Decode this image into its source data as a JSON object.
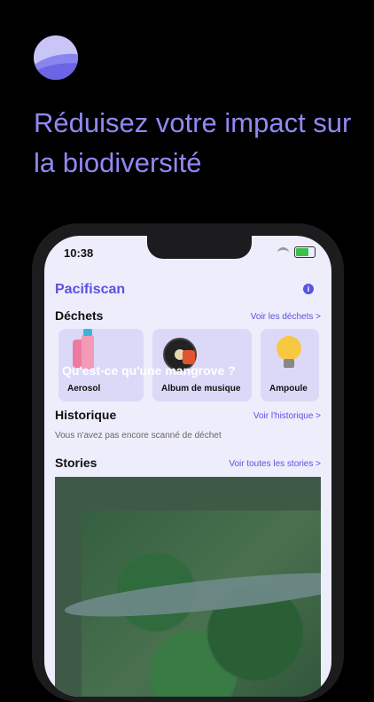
{
  "headline": "Réduisez votre impact sur la biodiversité",
  "phone": {
    "time": "10:38",
    "app_title": "Pacifiscan",
    "info_icon": "i",
    "dechets": {
      "title": "Déchets",
      "link": "Voir les déchets >",
      "items": [
        {
          "label": "Aerosol",
          "icon": "aerosol-icon"
        },
        {
          "label": "Album de musique",
          "icon": "vinyl-record-icon"
        },
        {
          "label": "Ampoule",
          "icon": "light-bulb-icon"
        }
      ]
    },
    "historique": {
      "title": "Historique",
      "link": "Voir l'historique >",
      "empty": "Vous n'avez pas encore scanné de déchet"
    },
    "stories": {
      "title": "Stories",
      "link": "Voir toutes les stories >",
      "caption": "Qu'est-ce qu'une mangrove ?"
    },
    "colors": {
      "accent": "#5a52e0",
      "headline": "#8f8af2",
      "background": "#000000"
    }
  }
}
